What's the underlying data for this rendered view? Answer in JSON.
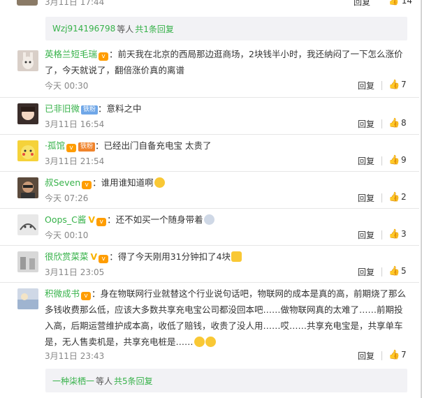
{
  "top": {
    "time": "3月11日 17:44",
    "reply": "回复",
    "likes": "14"
  },
  "more1": {
    "user": "Wzj914196798",
    "mid": "等人",
    "count": "共1条回复"
  },
  "comments": [
    {
      "user": "英格兰短毛瑞",
      "fan": "",
      "text": "：前天我在北京的西局那边逛商场，2块钱半小时，我还纳闷了一下怎么涨价了，今天就说了，翻倍涨价真的离谱",
      "time": "今天 00:30",
      "reply": "回复",
      "likes": "7",
      "avatarColor": "#d9cfc8"
    },
    {
      "user": "已非旧微",
      "fan": "铁粉",
      "text": "：意料之中",
      "time": "3月11日 16:54",
      "reply": "回复",
      "likes": "8",
      "avatarColor": "#3a2d2a"
    },
    {
      "user": "·孤馆",
      "fan": "铁粉",
      "text": "：已经出门自备充电宝 太贵了",
      "time": "3月11日 21:54",
      "reply": "回复",
      "likes": "9",
      "avatarColor": "#f5d23a"
    },
    {
      "user": "叔Seven",
      "fan": "",
      "text": "：谁用谁知道啊",
      "time": "今天 07:26",
      "reply": "回复",
      "likes": "2",
      "avatarColor": "#5b4a3c"
    },
    {
      "user": "Oops_C酱",
      "fan": "",
      "text": "：还不如买一个随身带着",
      "time": "今天 00:10",
      "reply": "回复",
      "likes": "3",
      "avatarColor": "#e8e8e8"
    },
    {
      "user": "很欣赏菜菜",
      "fan": "",
      "text": "：得了今天刚用31分钟扣了4块",
      "time": "3月11日 23:05",
      "reply": "回复",
      "likes": "5",
      "avatarColor": "#d8d8d8"
    },
    {
      "user": "积微成书",
      "fan": "",
      "text": "：身在物联网行业就替这个行业说句话吧，物联网的成本是真的高，前期烧了那么多钱收费那么低，应该大多数共享充电宝公司都没回本吧……做物联网真的太难了……前期投入高，后期运营维护成本高，收低了赔钱，收贵了没人用……哎……共享充电宝是，共享单车是，无人售卖机是，共享充电桩是……",
      "time": "3月11日 23:43",
      "reply": "回复",
      "likes": "7",
      "avatarColor": "#cfd8e6"
    }
  ],
  "more2": {
    "user": "一种柒栖一",
    "mid": "等人",
    "count": "共5条回复"
  }
}
